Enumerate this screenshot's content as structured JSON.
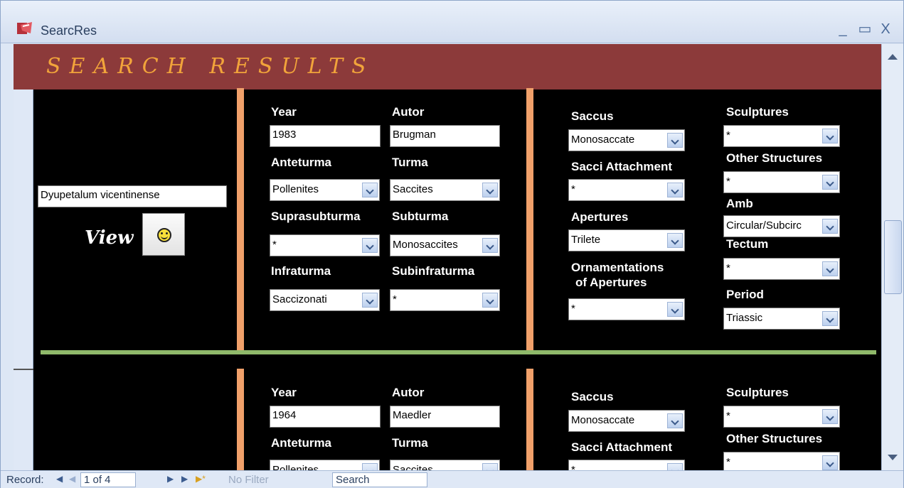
{
  "window": {
    "title": "SearcRes",
    "minimize": "_",
    "maximize": "▭",
    "close": "X"
  },
  "header": {
    "title": "SEARCH RESULTS"
  },
  "labels": {
    "year": "Year",
    "autor": "Autor",
    "anteturma": "Anteturma",
    "turma": "Turma",
    "suprasubturma": "Suprasubturma",
    "subturma": "Subturma",
    "infraturma": "Infraturma",
    "subinfraturma": "Subinfraturma",
    "saccus": "Saccus",
    "sacci_attachment": "Sacci Attachment",
    "apertures": "Apertures",
    "ornamentations_line1": "Ornamentations",
    "ornamentations_line2": "of Apertures",
    "sculptures": "Sculptures",
    "other_structures": "Other Structures",
    "amb": "Amb",
    "tectum": "Tectum",
    "period": "Period",
    "view": "View"
  },
  "records": [
    {
      "species": "Dyupetalum vicentinense",
      "year": "1983",
      "autor": "Brugman",
      "anteturma": "Pollenites",
      "turma": "Saccites",
      "suprasubturma": "*",
      "subturma": "Monosaccites",
      "infraturma": "Saccizonati",
      "subinfraturma": "*",
      "saccus": "Monosaccate",
      "sacci_attachment": "*",
      "apertures": "Trilete",
      "ornamentations": "*",
      "sculptures": "*",
      "other_structures": "*",
      "amb": "Circular/Subcirc",
      "tectum": "*",
      "period": "Triassic"
    },
    {
      "year": "1964",
      "autor": "Maedler",
      "anteturma": "Pollenites",
      "turma": "Saccites",
      "saccus": "Monosaccate",
      "sacci_attachment": "*",
      "sculptures": "*",
      "other_structures": "*"
    }
  ],
  "navbar": {
    "record_label": "Record:",
    "record_value": "1 of 4",
    "filter_label": "No Filter",
    "search_label": "Search",
    "first": "◀",
    "prev": "◀",
    "next": "▶",
    "last": "▶",
    "new": "▶*"
  }
}
